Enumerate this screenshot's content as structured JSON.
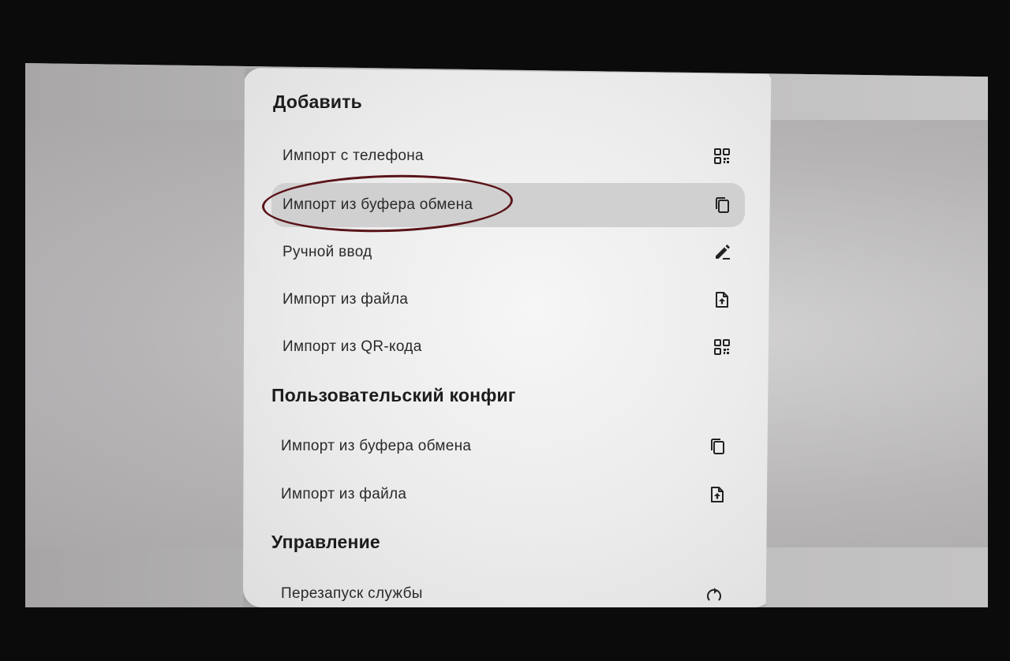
{
  "sections": [
    {
      "title": "Добавить",
      "items": [
        {
          "label": "Импорт с телефона",
          "icon": "qr-code-icon"
        },
        {
          "label": "Импорт из буфера обмена",
          "icon": "copy-icon",
          "focused": true
        },
        {
          "label": "Ручной ввод",
          "icon": "edit-icon"
        },
        {
          "label": "Импорт из файла",
          "icon": "file-upload-icon"
        },
        {
          "label": "Импорт из QR-кода",
          "icon": "qr-code-icon"
        }
      ]
    },
    {
      "title": "Пользовательский конфиг",
      "items": [
        {
          "label": "Импорт из буфера обмена",
          "icon": "copy-icon"
        },
        {
          "label": "Импорт из файла",
          "icon": "file-upload-icon"
        }
      ]
    },
    {
      "title": "Управление",
      "items": [
        {
          "label": "Перезапуск службы",
          "icon": "restart-icon"
        }
      ]
    }
  ],
  "colors": {
    "focus_background": "#d0d0d0",
    "annotation_oval": "#5a1419"
  }
}
